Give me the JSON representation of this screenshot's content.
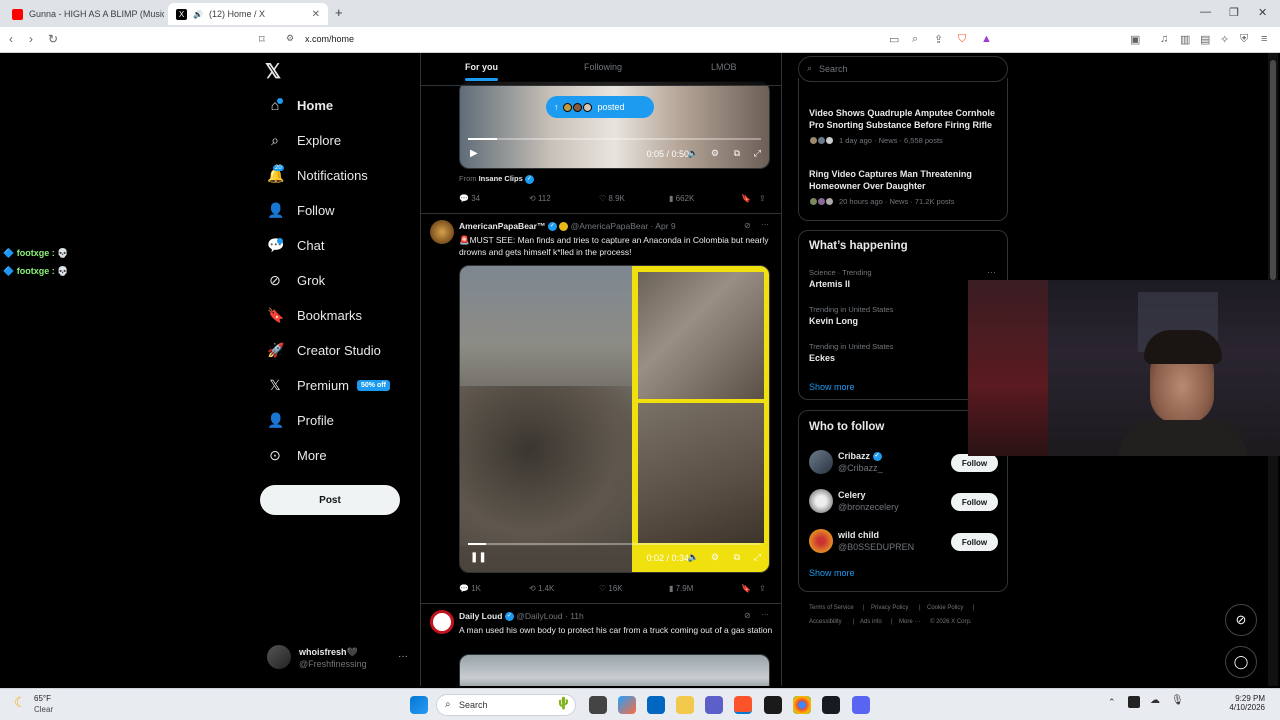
{
  "browser": {
    "tabs": [
      {
        "title": "Gunna - HIGH AS A BLIMP (Music Vid",
        "active": false
      },
      {
        "title": "(12) Home / X",
        "active": true
      }
    ],
    "url": "x.com/home"
  },
  "chat_overlay": [
    {
      "user": "footxge :",
      "emoji": "💀"
    },
    {
      "user": "footxge :",
      "emoji": "💀"
    }
  ],
  "sidebar": {
    "items": [
      {
        "label": "Home",
        "icon": "home-icon",
        "glyph": "⌂"
      },
      {
        "label": "Explore",
        "icon": "search-icon",
        "glyph": "⌕"
      },
      {
        "label": "Notifications",
        "icon": "bell-icon",
        "glyph": "🔔",
        "badge": "20"
      },
      {
        "label": "Follow",
        "icon": "person-add-icon",
        "glyph": "👤"
      },
      {
        "label": "Chat",
        "icon": "chat-icon",
        "glyph": "💬"
      },
      {
        "label": "Grok",
        "icon": "grok-icon",
        "glyph": "⊘"
      },
      {
        "label": "Bookmarks",
        "icon": "bookmark-icon",
        "glyph": "🔖"
      },
      {
        "label": "Creator Studio",
        "icon": "rocket-icon",
        "glyph": "🚀"
      },
      {
        "label": "Premium",
        "icon": "x-logo-icon",
        "glyph": "𝕏",
        "badge": "50% off"
      },
      {
        "label": "Profile",
        "icon": "profile-icon",
        "glyph": "👤"
      },
      {
        "label": "More",
        "icon": "more-circle-icon",
        "glyph": "⋯"
      }
    ],
    "post_label": "Post",
    "account": {
      "name": "whoisfresh🖤",
      "handle": "@Freshfinessing",
      "more": "···"
    }
  },
  "feed": {
    "tabs": [
      "For you",
      "Following",
      "LMOB"
    ],
    "tweet1": {
      "posted_pill": "posted",
      "video_time": "0:05 / 0:50",
      "video_progress": 0.1,
      "from_label": "From",
      "from_source": "Insane Clips",
      "actions": {
        "replies": "34",
        "reposts": "112",
        "likes": "8.9K",
        "views": "662K"
      }
    },
    "tweet2": {
      "name": "AmericanPapaBear™",
      "handle": "@AmericaPapaBear",
      "date": "· Apr 9",
      "text": "🚨MUST SEE: Man finds and tries to capture an Anaconda in Colombia but nearly drowns and gets himself k*lled in the process!",
      "video_time": "0:02 / 0:34",
      "video_progress": 0.06,
      "actions": {
        "replies": "1K",
        "reposts": "1.4K",
        "likes": "16K",
        "views": "7.9M"
      }
    },
    "tweet3": {
      "name": "Daily Loud",
      "handle": "@DailyLoud",
      "date": "· 11h",
      "text": "A man used his own body to protect his car from a truck coming out of a gas station"
    }
  },
  "right": {
    "search_placeholder": "Search",
    "news": [
      {
        "title": "Video Shows Quadruple Amputee Cornhole Pro Snorting Substance Before Firing Rifle",
        "meta": "1 day ago · News · 6,558 posts"
      },
      {
        "title": "Ring Video Captures Man Threatening Homeowner Over Daughter",
        "meta": "20 hours ago · News · 71.2K posts"
      }
    ],
    "whats_happening": {
      "title": "What’s happening",
      "trends": [
        {
          "meta": "Science · Trending",
          "name": "Artemis II"
        },
        {
          "meta": "Trending in United States",
          "name": "Kevin Long"
        },
        {
          "meta": "Trending in United States",
          "name": "Eckes"
        }
      ],
      "show_more": "Show more"
    },
    "who_to_follow": {
      "title": "Who to follow",
      "users": [
        {
          "name": "Cribazz",
          "handle": "@Cribazz_",
          "button": "Follow"
        },
        {
          "name": "Celery",
          "handle": "@bronzecelery",
          "button": "Follow"
        },
        {
          "name": "wild child",
          "handle": "@B0SSEDUPREN",
          "button": "Follow"
        }
      ],
      "show_more": "Show more"
    },
    "footer": [
      "Terms of Service",
      "|",
      "Privacy Policy",
      "|",
      "Cookie Policy",
      "|",
      "Accessibility",
      "|",
      "Ads info",
      "|",
      "More ···",
      "© 2026 X Corp."
    ]
  },
  "taskbar": {
    "weather_temp": "65°F",
    "weather_cond": "Clear",
    "search_placeholder": "Search",
    "time": "9:29 PM",
    "date": "4/10/2026"
  }
}
